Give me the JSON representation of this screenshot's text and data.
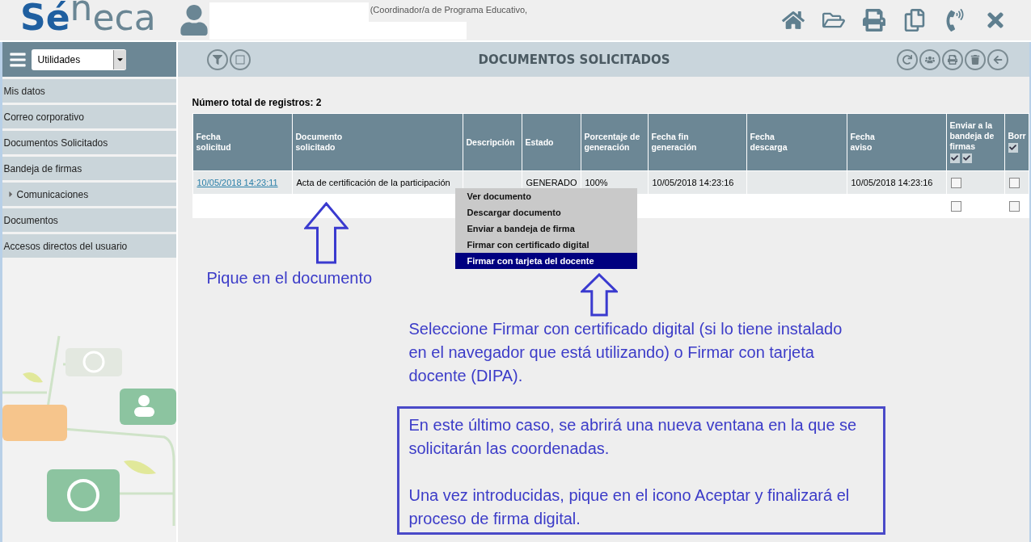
{
  "header": {
    "logo": [
      "Sé",
      "n",
      "eca"
    ],
    "role": "(Coordinador/a de Programa Educativo,"
  },
  "sidebar": {
    "select": "Utilidades",
    "items": [
      {
        "label": "Mis datos",
        "kind": "link"
      },
      {
        "label": "Correo corporativo",
        "kind": "link"
      },
      {
        "label": "Documentos Solicitados",
        "kind": "link"
      },
      {
        "label": "Bandeja de firmas",
        "kind": "link"
      },
      {
        "label": "Comunicaciones",
        "kind": "group",
        "expanded": false
      },
      {
        "label": "Documentos",
        "kind": "link"
      },
      {
        "label": "Accesos directos del usuario",
        "kind": "link"
      }
    ]
  },
  "page": {
    "title": "DOCUMENTOS SOLICITADOS",
    "total": "Número total de registros: 2"
  },
  "table": {
    "columns": [
      {
        "label": "Fecha\nsolicitud",
        "kind": "text"
      },
      {
        "label": "Documento\nsolicitado",
        "kind": "text"
      },
      {
        "label": "Descripción",
        "kind": "text"
      },
      {
        "label": "Estado",
        "kind": "text"
      },
      {
        "label": "Porcentaje de\ngeneración",
        "kind": "text"
      },
      {
        "label": "Fecha fin\ngeneración",
        "kind": "text"
      },
      {
        "label": "Fecha\ndescarga",
        "kind": "text"
      },
      {
        "label": "Fecha\naviso",
        "kind": "text"
      },
      {
        "label": "Enviar a la\nbandeja de\nfirmas",
        "kind": "send_check"
      },
      {
        "label": "Borr",
        "kind": "delete_check"
      }
    ],
    "rows": [
      {
        "cells": [
          "10/05/2018 14:23:11",
          "Acta de certificación de la participación",
          "",
          "GENERADO",
          "100%",
          "10/05/2018 14:23:16",
          "",
          "10/05/2018 14:23:16"
        ],
        "checks": [
          false,
          false
        ]
      },
      {
        "cells": [
          "",
          "",
          "",
          "",
          "",
          "",
          "",
          ""
        ],
        "checks": [
          false,
          false
        ]
      }
    ]
  },
  "context_menu": [
    {
      "label": "Ver documento",
      "selected": false
    },
    {
      "label": "Descargar documento",
      "selected": false
    },
    {
      "label": "Enviar a bandeja de firma",
      "selected": false
    },
    {
      "label": "Firmar con certificado digital",
      "selected": false
    },
    {
      "label": "Firmar con tarjeta del docente",
      "selected": true
    }
  ],
  "annotations": {
    "hint": "Pique en el documento",
    "instruction": "Seleccione Firmar con certificado digital (si lo tiene instalado en el navegador que está utilizando) o Firmar con tarjeta docente (DIPA).",
    "note": [
      "En este último caso, se abrirá una nueva ventana en la que se solicitarán las coordenadas.",
      "Una vez introducidas, pique en el icono Aceptar y finalizará el proceso de firma digital."
    ]
  }
}
